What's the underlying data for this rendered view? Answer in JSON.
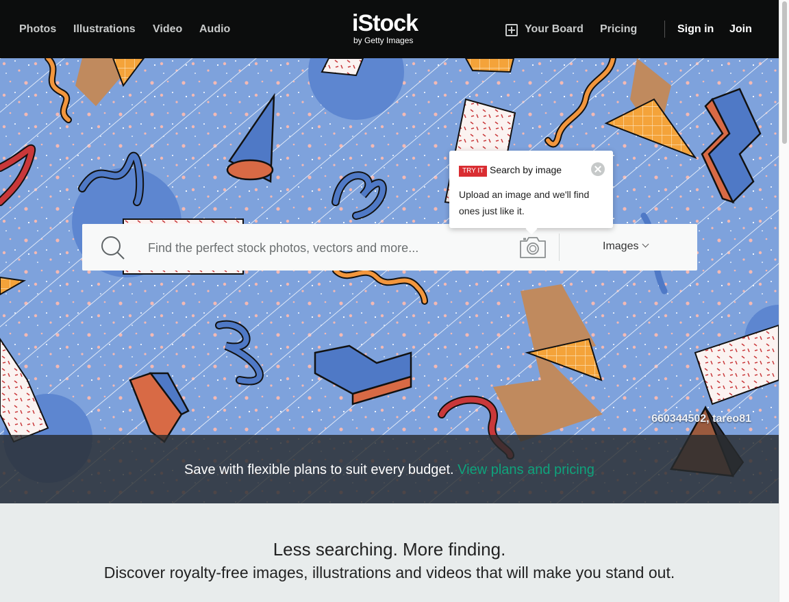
{
  "header": {
    "nav_left": [
      "Photos",
      "Illustrations",
      "Video",
      "Audio"
    ],
    "logo_main": "iStock",
    "logo_sub": "by Getty Images",
    "your_board": "Your Board",
    "pricing": "Pricing",
    "sign_in": "Sign in",
    "join": "Join"
  },
  "hero": {
    "credit": "660344502, tareo81",
    "search": {
      "placeholder": "Find the perfect stock photos, vectors and more...",
      "value": "",
      "media_type": "Images"
    },
    "tooltip": {
      "badge": "TRY IT",
      "title": "Search by image",
      "body": "Upload an image and we'll find ones just like it."
    },
    "banner": {
      "text": "Save with flexible plans to suit every budget.",
      "link": "View plans and pricing"
    }
  },
  "promo": {
    "headline": "Less searching. More finding.",
    "subhead": "Discover royalty-free images, illustrations and videos that will make you stand out."
  },
  "icons": [
    "board-add-icon",
    "search-icon",
    "camera-icon",
    "chevron-down-icon",
    "close-icon"
  ],
  "colors": {
    "header_bg": "#0c0d0d",
    "hero_bg": "#7ea2dc",
    "accent_link": "#0fa37c",
    "badge_red": "#d92d32",
    "page_bg": "#e8ecec"
  }
}
